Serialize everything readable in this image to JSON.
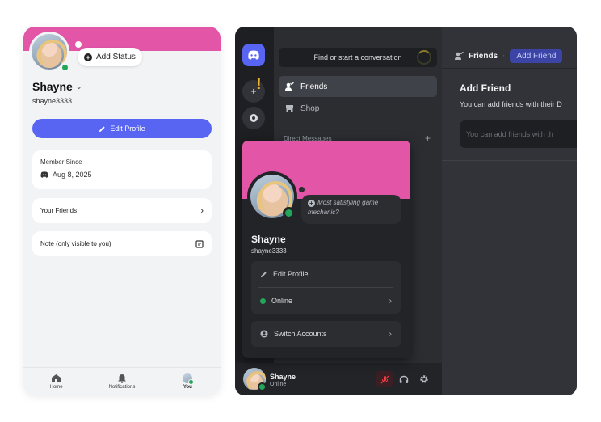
{
  "mobile": {
    "add_status": "Add Status",
    "display_name": "Shayne",
    "username": "shayne3333",
    "edit_profile": "Edit Profile",
    "member_since_label": "Member Since",
    "member_since_date": "Aug 8, 2025",
    "your_friends": "Your Friends",
    "note": "Note (only visible to you)",
    "tabs": [
      {
        "label": "Home",
        "icon": "home-icon"
      },
      {
        "label": "Notifications",
        "icon": "bell-icon"
      },
      {
        "label": "You",
        "icon": "avatar"
      }
    ]
  },
  "desktop": {
    "search_placeholder": "Find or start a conversation",
    "nav": [
      {
        "label": "Friends",
        "icon": "friends-icon"
      },
      {
        "label": "Shop",
        "icon": "shop-icon"
      }
    ],
    "direct_messages": "Direct Messages",
    "header": {
      "friends": "Friends",
      "add_friend_tab": "Add Friend"
    },
    "add_friend": {
      "title": "Add Friend",
      "subtitle": "You can add friends with their D",
      "input_placeholder": "You can add friends with th"
    },
    "user_bar": {
      "name": "Shayne",
      "status": "Online"
    },
    "popout": {
      "custom_status": "Most satisfying game mechanic?",
      "display_name": "Shayne",
      "username": "shayne3333",
      "edit_profile": "Edit Profile",
      "online": "Online",
      "switch_accounts": "Switch Accounts"
    }
  },
  "colors": {
    "banner": "#e255a7",
    "blurple": "#5865f2",
    "online": "#23a55a"
  }
}
